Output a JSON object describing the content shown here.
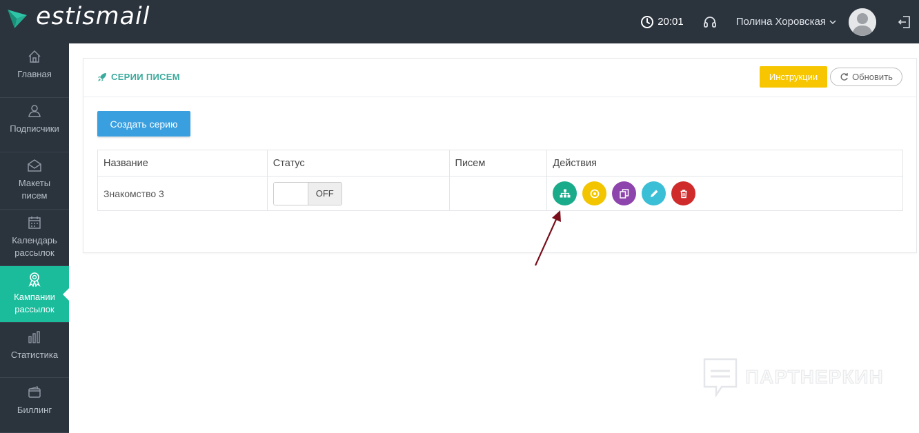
{
  "brand": {
    "name": "estismail"
  },
  "header": {
    "time": "20:01",
    "user_name": "Полина Хоровская"
  },
  "sidebar": {
    "items": [
      {
        "label": "Главная",
        "icon": "home-icon"
      },
      {
        "label": "Подписчики",
        "icon": "users-icon"
      },
      {
        "label": "Макеты писем",
        "icon": "envelope-icon"
      },
      {
        "label": "Календарь рассылок",
        "icon": "calendar-icon"
      },
      {
        "label": "Кампании рассылок",
        "icon": "award-icon",
        "active": true
      },
      {
        "label": "Статистика",
        "icon": "bar-chart-icon"
      },
      {
        "label": "Биллинг",
        "icon": "wallet-icon"
      }
    ]
  },
  "panel": {
    "title": "СЕРИИ ПИСЕМ",
    "instructions_label": "Инструкции",
    "refresh_label": "Обновить",
    "create_label": "Создать серию"
  },
  "table": {
    "columns": [
      "Название",
      "Статус",
      "Писем",
      "Действия"
    ],
    "rows": [
      {
        "name": "Знакомство 3",
        "status": "OFF",
        "letters": ""
      }
    ]
  },
  "actions": [
    {
      "name": "structure",
      "color": "#1aab8b"
    },
    {
      "name": "target",
      "color": "#f2c500"
    },
    {
      "name": "copy",
      "color": "#8e44ad"
    },
    {
      "name": "edit",
      "color": "#3bbfd6"
    },
    {
      "name": "delete",
      "color": "#d02b2b"
    }
  ],
  "watermark": {
    "text": "ПАРТНЕРКИН"
  },
  "colors": {
    "sidebar_bg": "#2b333d",
    "accent": "#1abc9c",
    "primary": "#3a9fdf",
    "warning": "#f7c600",
    "arrow": "#7a0f1c"
  }
}
